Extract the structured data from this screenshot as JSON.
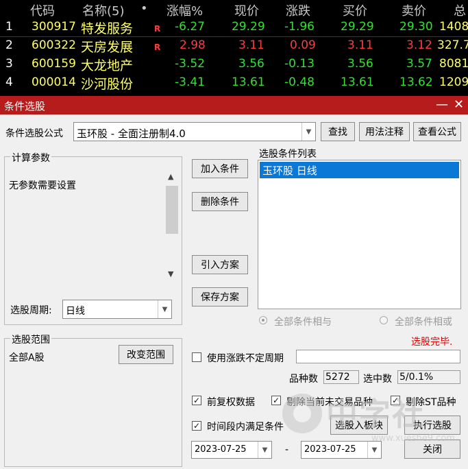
{
  "table": {
    "headers": [
      "代码",
      "名称(5)",
      "•",
      "涨幅%",
      "现价",
      "涨跌",
      "买价",
      "卖价",
      "总"
    ],
    "rows": [
      {
        "idx": "1",
        "code": "300917",
        "name": "特发服务",
        "flag": "R",
        "pct": "-6.27",
        "price": "29.29",
        "chg": "-1.96",
        "bid": "29.29",
        "ask": "29.30",
        "total": "1408"
      },
      {
        "idx": "2",
        "code": "600322",
        "name": "天房发展",
        "flag": "R",
        "pct": "2.98",
        "price": "3.11",
        "chg": "0.09",
        "bid": "3.11",
        "ask": "3.12",
        "total": "327.7"
      },
      {
        "idx": "3",
        "code": "600159",
        "name": "大龙地产",
        "flag": "",
        "pct": "-3.52",
        "price": "3.56",
        "chg": "-0.13",
        "bid": "3.56",
        "ask": "3.57",
        "total": "8081"
      },
      {
        "idx": "4",
        "code": "000014",
        "name": "沙河股份",
        "flag": "",
        "pct": "-3.41",
        "price": "13.61",
        "chg": "-0.48",
        "bid": "13.61",
        "ask": "13.62",
        "total": "1209"
      }
    ]
  },
  "dialog": {
    "title": "条件选股",
    "minimize": "—",
    "close": "✕",
    "formula_label": "条件选股公式",
    "formula_value": "玉环股  -  全面注册制4.0",
    "find_btn": "查找",
    "usage_btn": "用法注释",
    "view_btn": "查看公式",
    "calc_group": "计算参数",
    "no_params": "无参数需要设置",
    "period_label": "选股周期:",
    "period_value": "日线",
    "add_btn": "加入条件",
    "del_btn": "删除条件",
    "import_btn": "引入方案",
    "save_btn": "保存方案",
    "list_title": "选股条件列表",
    "list_items": [
      "玉环股  日线"
    ],
    "radio_and": "全部条件相与",
    "radio_or": "全部条件相或",
    "status": "选股完毕.",
    "scope_group": "选股范围",
    "scope_value": "全部A股",
    "change_scope_btn": "改变范围",
    "uncertain_period": "使用涨跌不定周期",
    "count_label": "品种数",
    "count_value": "5272",
    "selected_label": "选中数",
    "selected_value": "5/0.1%",
    "adj_label": "前复权数据",
    "exclude_untraded": "剔除当前未交易品种",
    "exclude_st": "剔除ST品种",
    "time_range": "时间段内满足条件",
    "to_board_btn": "选股入板块",
    "run_btn": "执行选股",
    "date_from": "2023-07-25",
    "date_sep": "-",
    "date_to": "2023-07-25",
    "close_btn": "关闭",
    "watermark_text": "中字社",
    "watermark_url": "www.xueshe9.com"
  },
  "colors": {
    "up": "#ff3c3c",
    "down": "#33e033",
    "code": "#ffff66",
    "name": "#ffff66",
    "titlebar": "#b71c1c",
    "status": "#e00000",
    "selection": "#0a78d7"
  }
}
